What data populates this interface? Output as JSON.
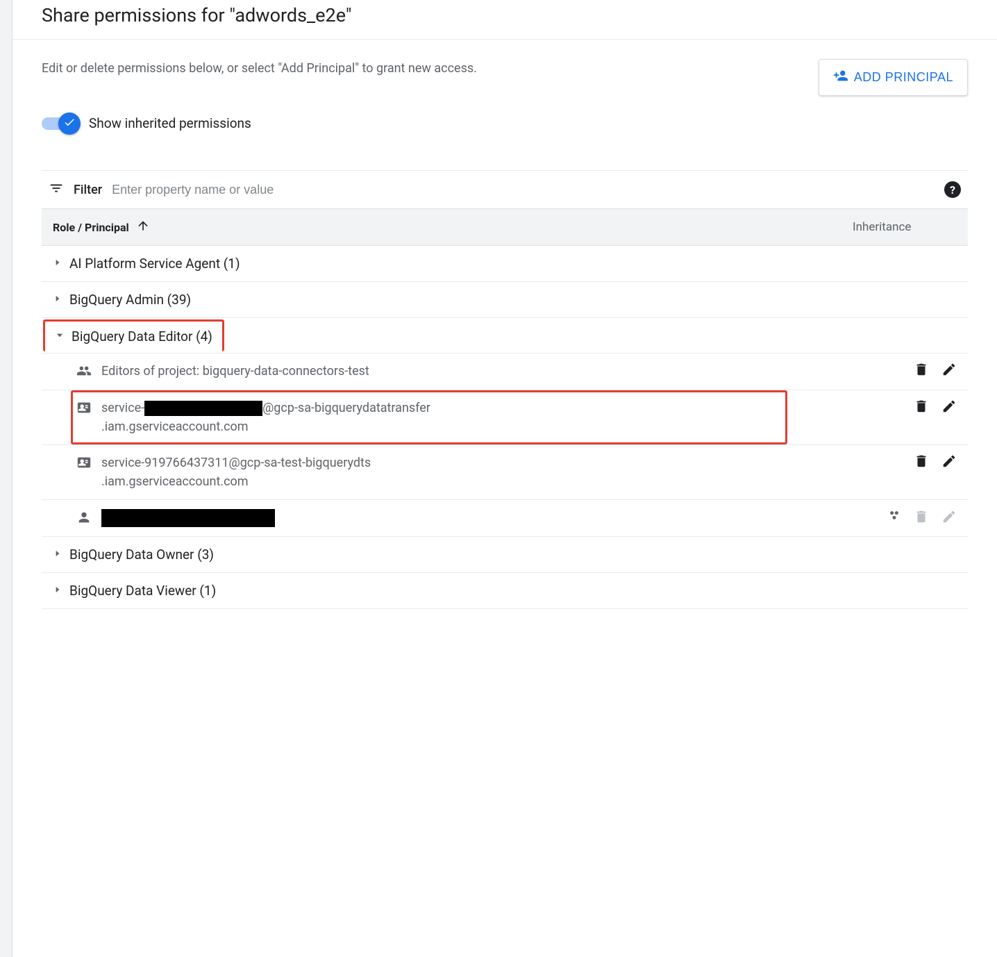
{
  "header": {
    "title": "Share permissions for \"adwords_e2e\""
  },
  "description": "Edit or delete permissions below, or select \"Add Principal\" to grant new access.",
  "addButton": "ADD PRINCIPAL",
  "toggle": {
    "label": "Show inherited permissions",
    "enabled": true
  },
  "filter": {
    "label": "Filter",
    "placeholder": "Enter property name or value"
  },
  "columns": {
    "role": "Role / Principal",
    "inheritance": "Inheritance"
  },
  "roles": [
    {
      "name": "AI Platform Service Agent",
      "count": 1,
      "expanded": false
    },
    {
      "name": "BigQuery Admin",
      "count": 39,
      "expanded": false
    },
    {
      "name": "BigQuery Data Editor",
      "count": 4,
      "expanded": true,
      "highlighted": true
    },
    {
      "name": "BigQuery Data Owner",
      "count": 3,
      "expanded": false
    },
    {
      "name": "BigQuery Data Viewer",
      "count": 1,
      "expanded": false
    }
  ],
  "principals": [
    {
      "type": "group",
      "text": "Editors of project: bigquery-data-connectors-test",
      "inherited": false,
      "deletable": true,
      "editable": true,
      "highlighted": false
    },
    {
      "type": "service-account",
      "prefix": "service-",
      "redacted": true,
      "suffix": "@gcp-sa-bigquerydatatransfer",
      "line2": ".iam.gserviceaccount.com",
      "inherited": false,
      "deletable": true,
      "editable": true,
      "highlighted": true
    },
    {
      "type": "service-account",
      "text": "service-919766437311@gcp-sa-test-bigquerydts",
      "line2": ".iam.gserviceaccount.com",
      "inherited": false,
      "deletable": true,
      "editable": true,
      "highlighted": false
    },
    {
      "type": "user",
      "fullRedacted": true,
      "inherited": true,
      "deletable": false,
      "editable": false,
      "highlighted": false
    }
  ]
}
